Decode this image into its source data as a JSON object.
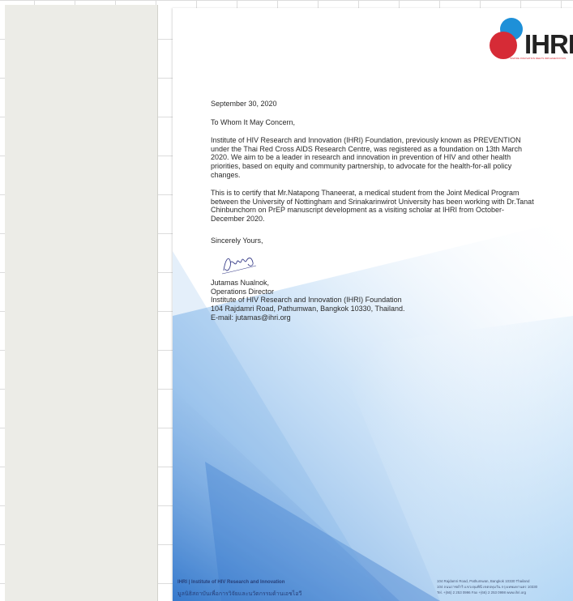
{
  "letter": {
    "date": "September 30, 2020",
    "salutation": "To Whom It May Concern,",
    "paragraph1": "Institute of HIV Research and Innovation (IHRI) Foundation, previously known as PREVENTION under the Thai Red Cross AIDS Research Centre, was registered as a foundation on 13th March 2020. We aim to be a leader in research and innovation in prevention of HIV and other health priorities, based on equity and community partnership, to advocate for the health-for-all policy changes.",
    "paragraph2": "This is to certify that Mr.Natapong Thaneerat, a medical student from the Joint Medical Program between the University of Nottingham and Srinakarinwirot University has been working with Dr.Tanat Chinbunchorn on PrEP manuscript development as a visiting scholar at IHRI from October- December 2020.",
    "closing": "Sincerely Yours,",
    "signer": {
      "name": "Jutamas Nualnok,",
      "title": "Operations Director",
      "org": "Institute of HIV Research and Innovation (IHRI) Foundation",
      "address": "104 Rajdamri Road, Pathumwan, Bangkok 10330, Thailand.",
      "email": "E-mail: jutamas@ihri.org"
    }
  },
  "logo": {
    "text": "IHRI",
    "tagline": "INSPIRE INNOVATION MEETS IMPLEMENTATION"
  },
  "footer": {
    "left_line1": "IHRI | Institute of HIV Research and Innovation",
    "left_line2": "มูลนิธิสถาบันเพื่อการวิจัยและนวัตกรรมด้านเอชไอวี",
    "right_line1": "104 Rajdamri Road, Pathumwan, Bangkok 10330 Thailand",
    "right_line2": "104 ถนนราชดำริ แขวงลุมพินี เขตปทุมวัน กรุงเทพมหานคร 10330",
    "right_line3": "Tel. +(66) 2 253 0996  Fax +(66) 2 253 0998  www.ihri.org"
  },
  "colors": {
    "brand_red": "#d62b36",
    "brand_blue": "#1e90d8",
    "sidebar_bg": "#ecece7"
  }
}
